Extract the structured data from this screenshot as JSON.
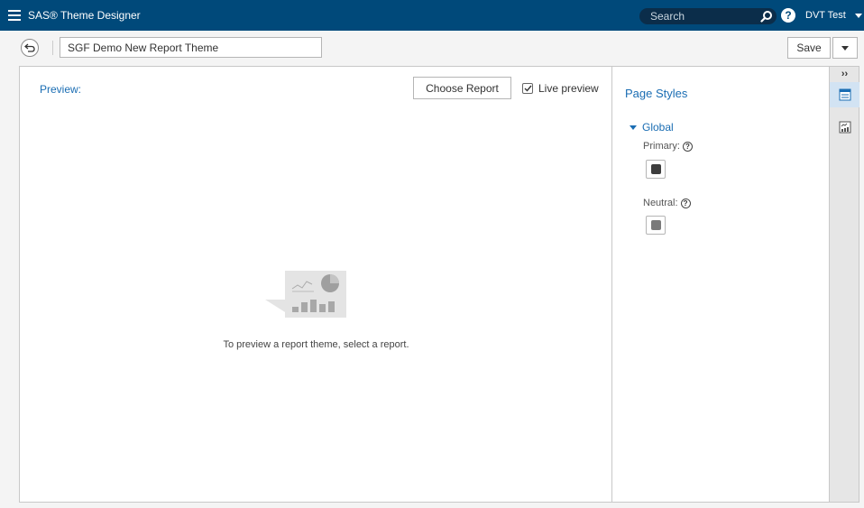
{
  "app": {
    "title": "SAS® Theme Designer",
    "accent_color": "#00497a",
    "link_color": "#1a6db3"
  },
  "header": {
    "menu_icon": "hamburger-icon",
    "search": {
      "placeholder": "Search",
      "icon": "search-icon"
    },
    "help_icon": "help-icon",
    "help_glyph": "?",
    "user": {
      "name": "DVT Test",
      "icon": "caret-down-icon"
    }
  },
  "toolbar": {
    "back_icon": "back-arrow-icon",
    "theme_name": "SGF Demo New Report Theme",
    "save_label": "Save",
    "save_menu_icon": "caret-down-icon"
  },
  "preview": {
    "label": "Preview:",
    "choose_report_label": "Choose Report",
    "live_preview": {
      "label": "Live preview",
      "checked": true
    },
    "empty_icon": "report-chart-placeholder-icon",
    "empty_message": "To preview a report theme, select a report."
  },
  "page_styles": {
    "title": "Page Styles",
    "section": {
      "label": "Global",
      "expanded": true
    },
    "properties": [
      {
        "label": "Primary:",
        "color": "#3d3d3d",
        "help_glyph": "?"
      },
      {
        "label": "Neutral:",
        "color": "#7a7a7a",
        "help_glyph": "?"
      }
    ]
  },
  "rail": {
    "collapse_glyph": "››",
    "tabs": [
      {
        "icon": "page-styles-icon",
        "active": true
      },
      {
        "icon": "report-objects-icon",
        "active": false
      }
    ]
  }
}
